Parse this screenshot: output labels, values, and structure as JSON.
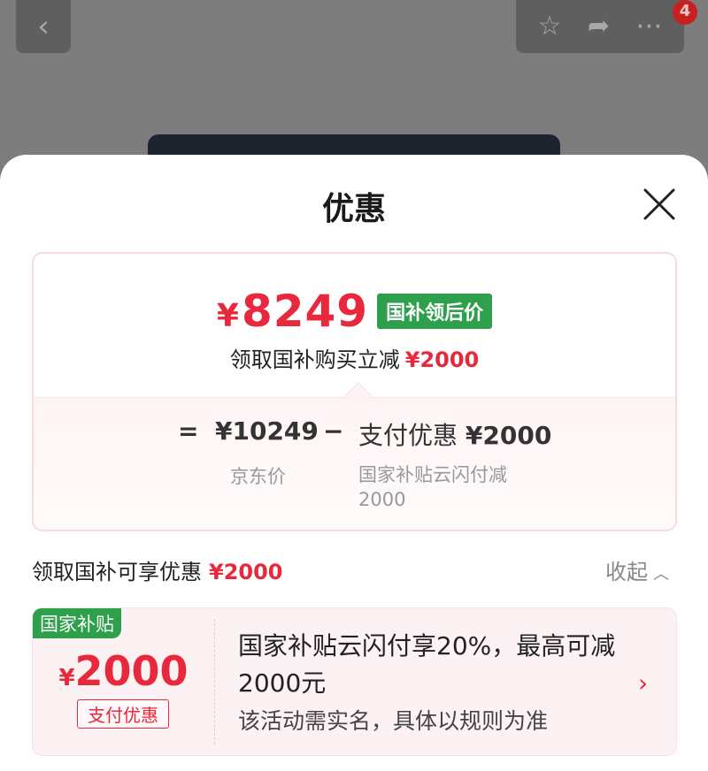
{
  "background": {
    "badge_count": "4",
    "icons": [
      "back-icon",
      "star-icon",
      "share-icon",
      "more-icon"
    ]
  },
  "sheet": {
    "title": "优惠",
    "close_icon": "close-icon"
  },
  "price_card": {
    "final_price": "8249",
    "currency": "¥",
    "final_price_tag": "国补领后价",
    "subline_text": "领取国补购买立减",
    "subline_amount": "¥2000",
    "formula": {
      "equals": "=",
      "jd_price": "¥10249",
      "minus": "−",
      "pay_label": "支付优惠",
      "pay_amount": "¥2000",
      "jd_price_label": "京东价",
      "pay_desc": "国家补贴云闪付减2000"
    }
  },
  "section": {
    "title": "领取国补可享优惠",
    "amount": "¥2000",
    "collapse_label": "收起"
  },
  "coupon": {
    "tag": "国家补贴",
    "currency": "¥",
    "amount": "2000",
    "type_label": "支付优惠",
    "description": "国家补贴云闪付享20%，最高可减2000元",
    "note": "该活动需实名，具体以规则为准"
  },
  "colors": {
    "accent_red": "#e8283c",
    "green_tag": "#2e9f4b",
    "overlay": "#7d7d7d"
  }
}
